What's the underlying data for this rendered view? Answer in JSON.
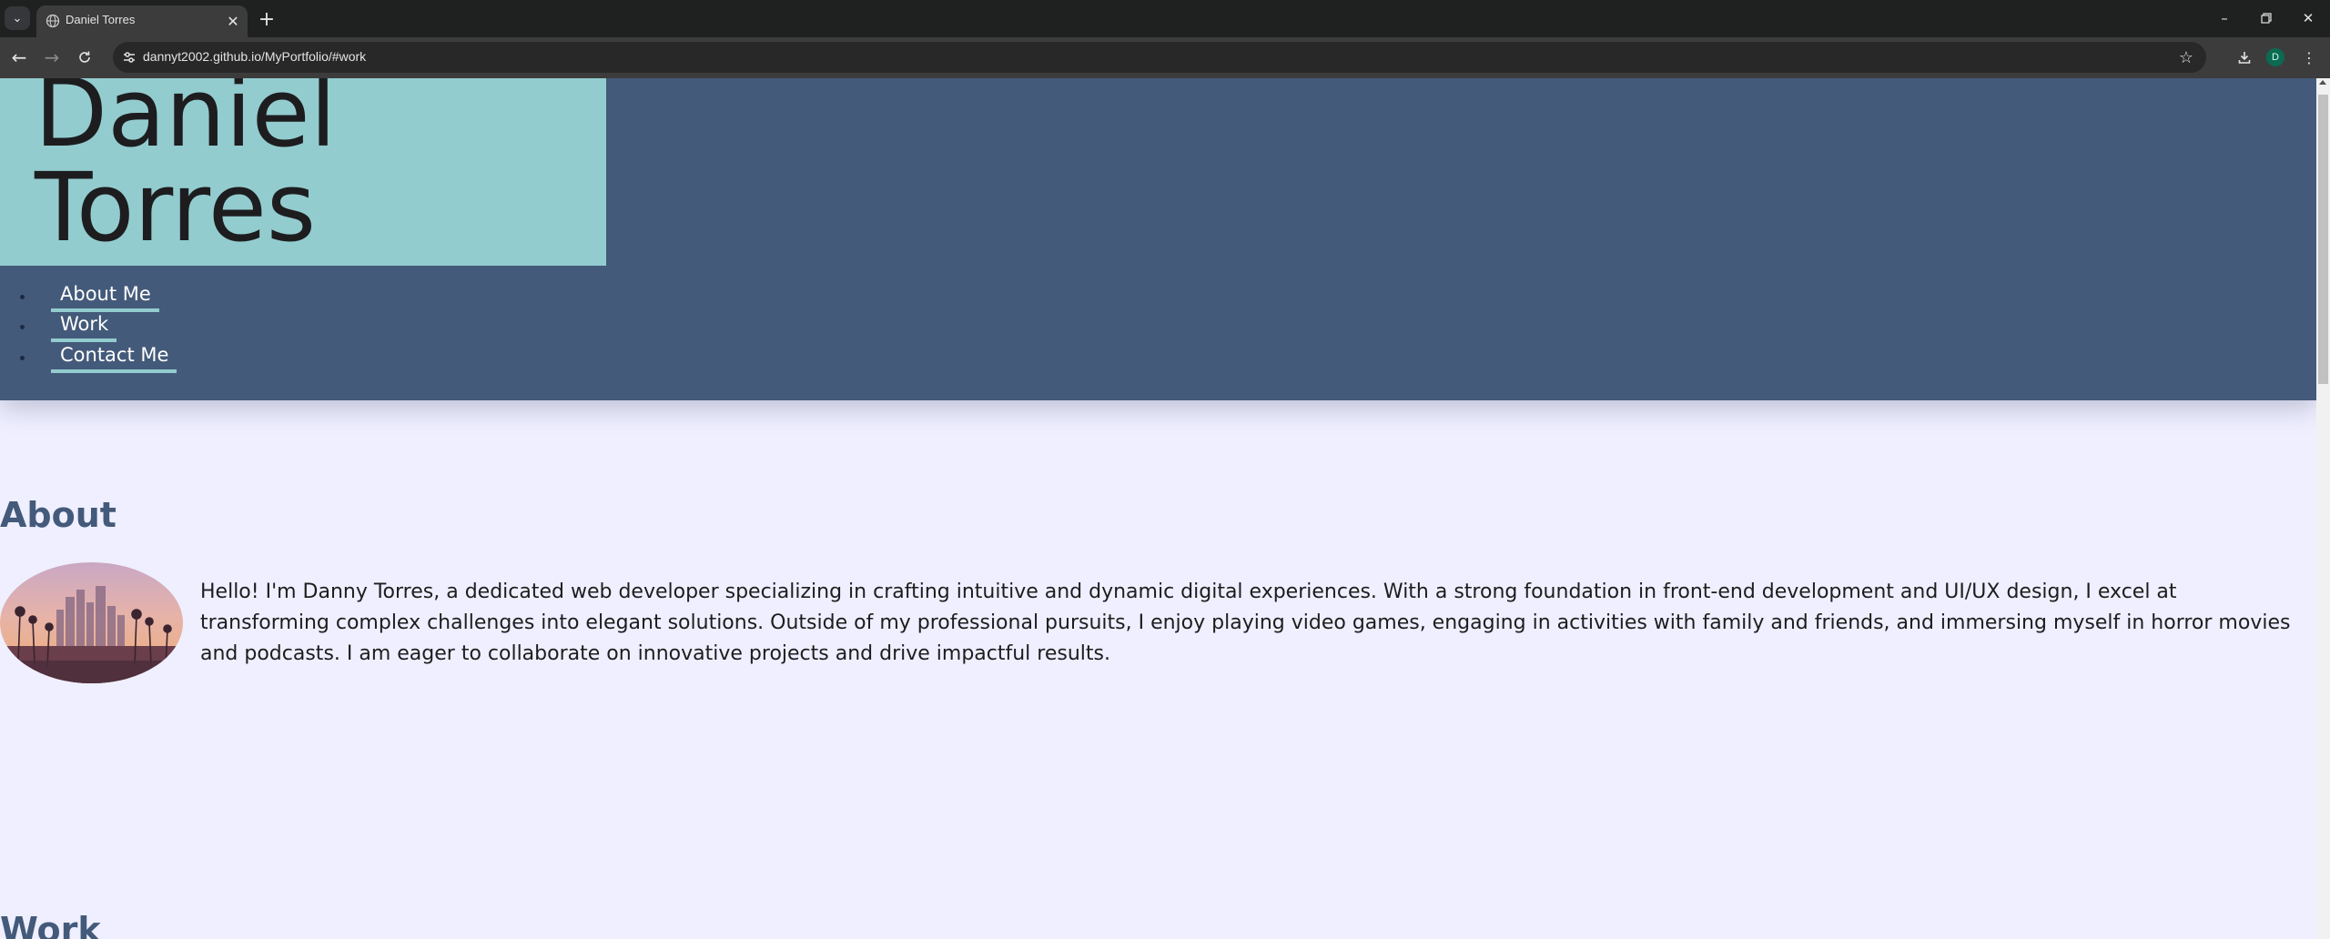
{
  "browser": {
    "tab_title": "Daniel Torres",
    "url": "dannyt2002.github.io/MyPortfolio/#work",
    "profile_initial": "D"
  },
  "header": {
    "name_first": "Daniel",
    "name_last": "Torres",
    "nav": [
      {
        "label": "About Me"
      },
      {
        "label": "Work"
      },
      {
        "label": "Contact Me"
      }
    ]
  },
  "about": {
    "heading": "About",
    "text": "Hello! I'm Danny Torres, a dedicated web developer specializing in crafting intuitive and dynamic digital experiences. With a strong foundation in front-end development and UI/UX design, I excel at transforming complex challenges into elegant solutions. Outside of my professional pursuits, I enjoy playing video games, engaging in activities with family and friends, and immersing myself in horror movies and podcasts. I am eager to collaborate on innovative projects and drive impactful results."
  },
  "work": {
    "heading": "Work"
  },
  "colors": {
    "header_bg": "#445a7a",
    "name_block_bg": "#93cccf",
    "page_bg": "#efefff",
    "accent": "#93cccf"
  }
}
